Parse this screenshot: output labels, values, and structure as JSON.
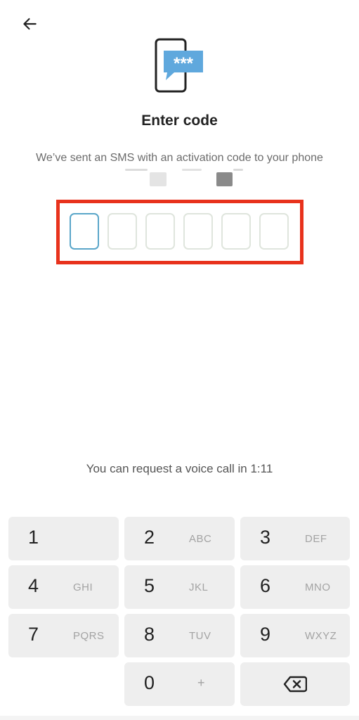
{
  "header": {
    "back_icon": "arrow-left-icon"
  },
  "illustration": {
    "icon": "phone-sms-icon",
    "bubble_text": "***",
    "bubble_color": "#5fa8dd"
  },
  "title": "Enter code",
  "subtitle": "We’ve sent an SMS with an activation code to your phone",
  "code": {
    "length": 6,
    "values": [
      "",
      "",
      "",
      "",
      "",
      ""
    ],
    "active_index": 0,
    "active_color": "#5aa6c9",
    "highlight_color": "#e8321c"
  },
  "voice_call_text": "You can request a voice call in 1:11",
  "keypad": {
    "keys": [
      {
        "digit": "1",
        "letters": ""
      },
      {
        "digit": "2",
        "letters": "ABC"
      },
      {
        "digit": "3",
        "letters": "DEF"
      },
      {
        "digit": "4",
        "letters": "GHI"
      },
      {
        "digit": "5",
        "letters": "JKL"
      },
      {
        "digit": "6",
        "letters": "MNO"
      },
      {
        "digit": "7",
        "letters": "PQRS"
      },
      {
        "digit": "8",
        "letters": "TUV"
      },
      {
        "digit": "9",
        "letters": "WXYZ"
      },
      {
        "digit": "0",
        "letters": "+"
      }
    ],
    "backspace_icon": "backspace-icon"
  }
}
